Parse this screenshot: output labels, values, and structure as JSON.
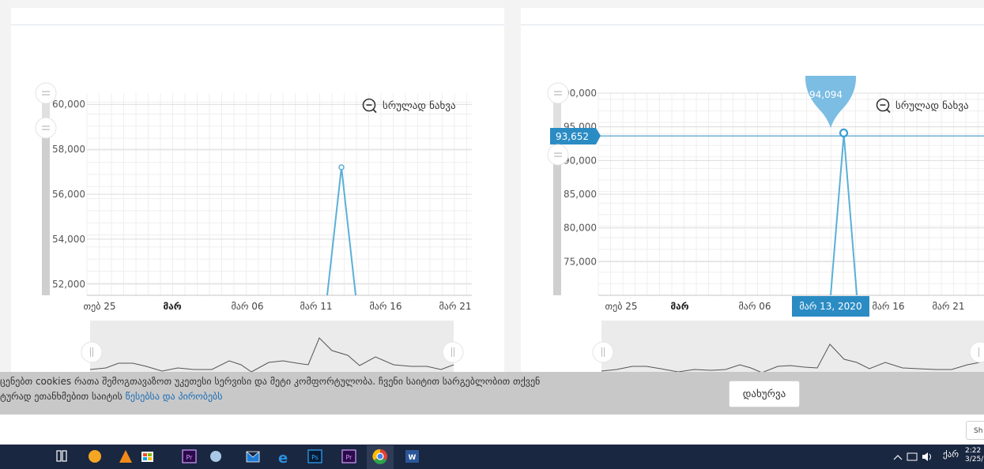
{
  "chart_data": [
    {
      "type": "line",
      "y_ticks": [
        "60,000",
        "58,000",
        "56,000",
        "54,000",
        "52,000"
      ],
      "ylim": [
        51500,
        60500
      ],
      "x_ticks": [
        "თებ 25",
        "მარ",
        "მარ 06",
        "მარ 11",
        "მარ 16",
        "მარ 21"
      ],
      "series": [
        {
          "x": [
            "მარ 12",
            "მარ 13",
            "მარ 13",
            "მარ 14"
          ],
          "values": [
            51500,
            57200,
            57200,
            51500
          ]
        }
      ],
      "reset_zoom_label": "სრულად ნახვა",
      "grid": true
    },
    {
      "type": "line",
      "y_ticks": [
        "100,000",
        "95,000",
        "90,000",
        "85,000",
        "80,000",
        "75,000"
      ],
      "ylim": [
        70000,
        100000
      ],
      "x_ticks": [
        "თებ 25",
        "მარ",
        "მარ 06",
        "მარ 11",
        "მარ 16",
        "მარ 21"
      ],
      "series": [
        {
          "x": [
            "მარ 12",
            "მარ 13",
            "მარ 13",
            "მარ 14"
          ],
          "values": [
            70000,
            93652,
            94094,
            70000
          ]
        }
      ],
      "reset_zoom_label": "სრულად ნახვა",
      "tooltip_value": "94,094",
      "crosshair_y_label": "93,652",
      "crosshair_x_label": "მარ 13, 2020",
      "grid": true
    }
  ],
  "cookie": {
    "line1": "ცენებთ cookies რათა შემოგთავაზოთ უკეთესი სერვისი და მეტი კომფორტულობა. ჩვენი საიტით სარგებლობით თქვენ",
    "line2_prefix": "ტურად ეთანხმებით საიტის ",
    "line2_link": "წესებსა და პირობებს",
    "close_label": "დახურვა"
  },
  "show_button_label": "Sh",
  "taskbar": {
    "tray_lang": "ქარ",
    "time": "2:22",
    "date": "3/25/"
  },
  "colors": {
    "accent": "#2b8cc4",
    "line": "#5ab0d8",
    "tooltip": "#7bbde3",
    "taskbar": "#1a2740"
  }
}
